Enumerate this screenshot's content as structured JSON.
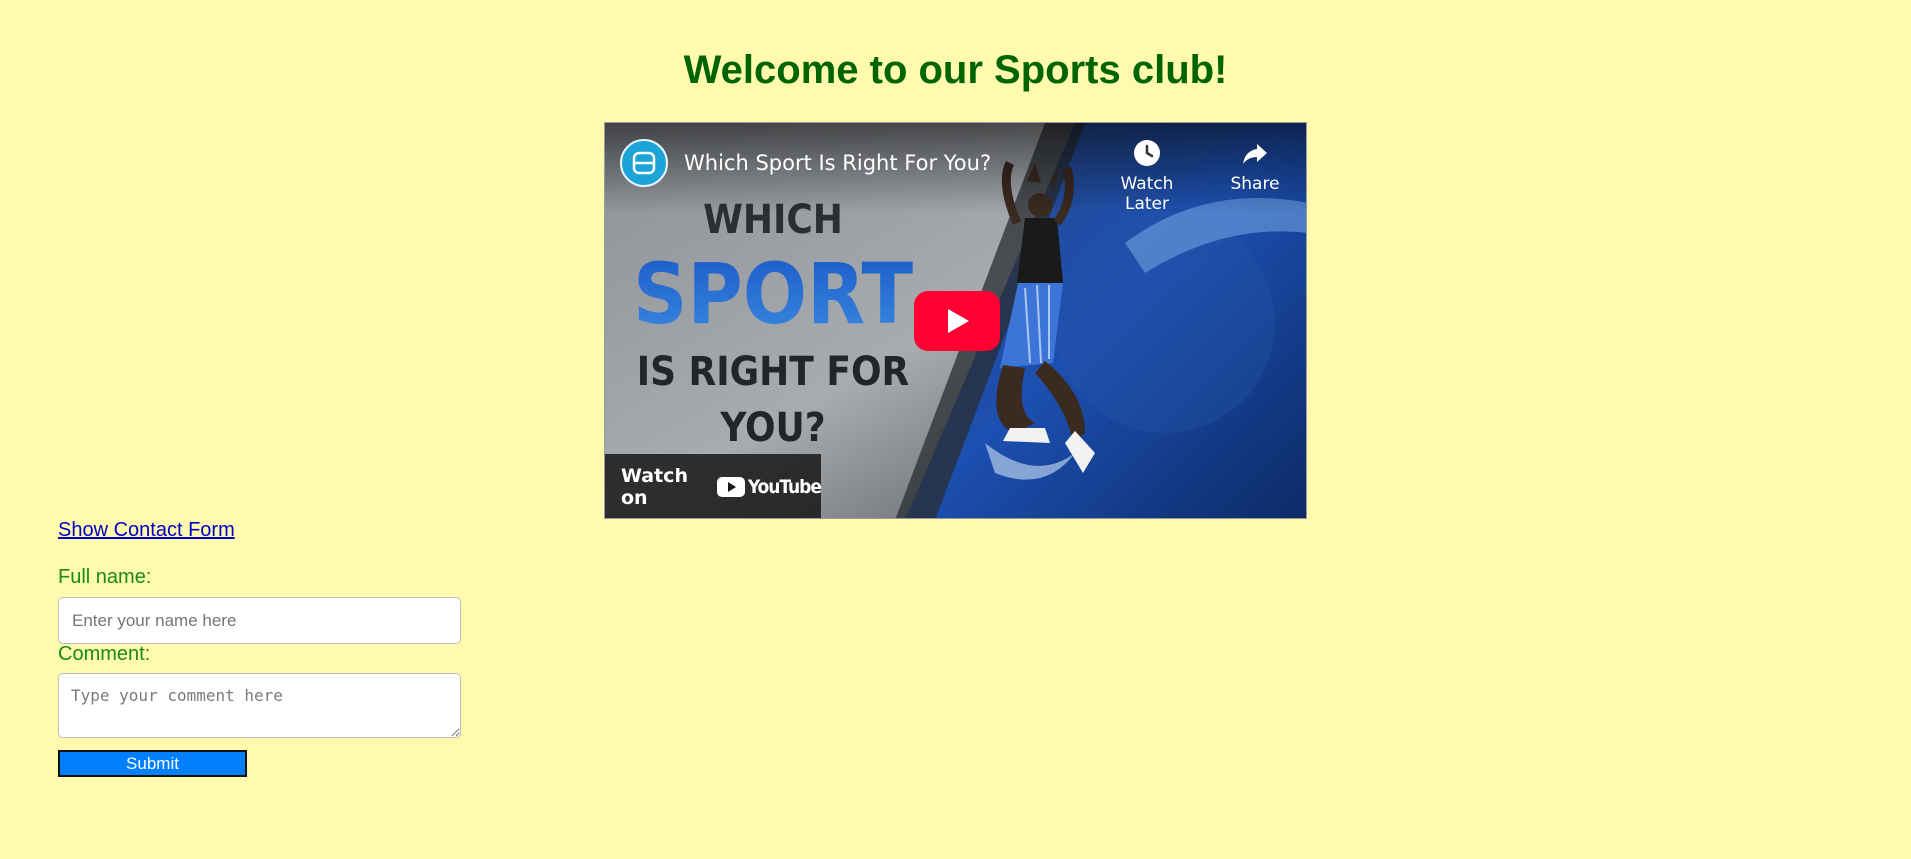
{
  "page": {
    "title": "Welcome to our Sports club!"
  },
  "video": {
    "title": "Which Sport Is Right For You?",
    "channel_icon": "b-logo-icon",
    "thumbnail_lines": [
      "WHICH",
      "SPORT",
      "IS RIGHT FOR",
      "YOU?"
    ],
    "watch_later_label": "Watch Later",
    "share_label": "Share",
    "watch_on_label": "Watch on",
    "youtube_wordmark": "YouTube",
    "colors": {
      "play_button": "#ff0033",
      "channel_badge": "#1ca3d8",
      "thumb_text_dark": "#2b2f33",
      "thumb_text_blue": "#1f63c8"
    }
  },
  "contact": {
    "show_link": "Show Contact Form",
    "name_label": "Full name:",
    "name_placeholder": "Enter your name here",
    "name_value": "",
    "comment_label": "Comment:",
    "comment_placeholder": "Type your comment here",
    "comment_value": "",
    "submit_label": "Submit"
  },
  "colors": {
    "background": "#fffaad",
    "title": "#006400",
    "labels": "#1a8a1a",
    "link": "#0000cc",
    "submit": "#0080ff"
  }
}
